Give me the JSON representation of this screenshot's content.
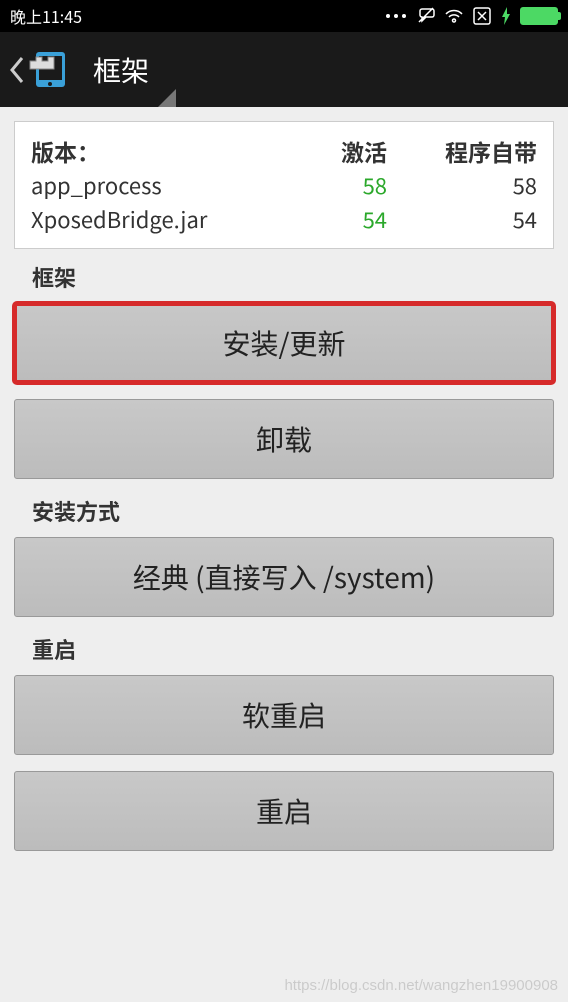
{
  "statusBar": {
    "time": "晚上11:45"
  },
  "header": {
    "title": "框架"
  },
  "versionCard": {
    "versionLabel": "版本：",
    "activeLabel": "激活",
    "bundledLabel": "程序自带",
    "rows": [
      {
        "name": "app_process",
        "active": "58",
        "bundled": "58"
      },
      {
        "name": "XposedBridge.jar",
        "active": "54",
        "bundled": "54"
      }
    ]
  },
  "sections": {
    "framework": {
      "label": "框架",
      "installUpdate": "安装/更新",
      "uninstall": "卸载"
    },
    "installMode": {
      "label": "安装方式",
      "classic": "经典 (直接写入 /system)"
    },
    "reboot": {
      "label": "重启",
      "softReboot": "软重启",
      "reboot": "重启"
    }
  },
  "watermark": "https://blog.csdn.net/wangzhen19900908"
}
